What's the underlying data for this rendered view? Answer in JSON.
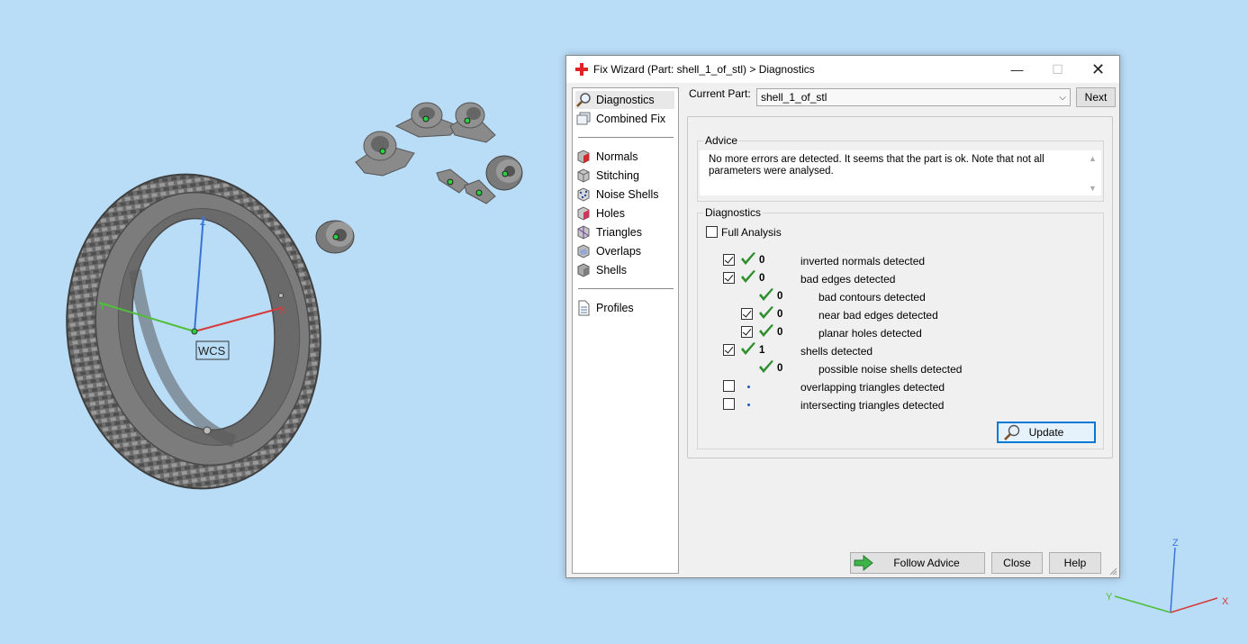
{
  "viewport": {
    "background": "#b9dcf7",
    "wcs_label": "WCS",
    "axes": {
      "x": "X",
      "y": "Y",
      "z": "Z"
    },
    "colors": {
      "x_axis": "#d63a3a",
      "y_axis": "#4fbf3a",
      "z_axis": "#3a73d6",
      "part": "#7a7a7a"
    }
  },
  "dialog": {
    "title": "Fix Wizard (Part: shell_1_of_stl) > Diagnostics",
    "title_icon": "red-cross-icon",
    "window_controls": {
      "minimize": "—",
      "maximize": "☐",
      "close": "✕"
    },
    "nav": {
      "items": [
        {
          "label": "Diagnostics",
          "icon": "magnifier-icon",
          "selected": true
        },
        {
          "label": "Combined Fix",
          "icon": "stack-icon"
        },
        {
          "label": "Normals",
          "icon": "cube-red-face-icon"
        },
        {
          "label": "Stitching",
          "icon": "cube-stitch-icon"
        },
        {
          "label": "Noise Shells",
          "icon": "cube-noise-icon"
        },
        {
          "label": "Holes",
          "icon": "cube-hole-icon"
        },
        {
          "label": "Triangles",
          "icon": "cube-triangle-icon"
        },
        {
          "label": "Overlaps",
          "icon": "cube-overlap-icon"
        },
        {
          "label": "Shells",
          "icon": "cube-shells-icon"
        },
        {
          "label": "Profiles",
          "icon": "document-icon"
        }
      ]
    },
    "current_part": {
      "label": "Current Part:",
      "value": "shell_1_of_stl"
    },
    "next_label": "Next",
    "advice": {
      "title": "Advice",
      "text": "No more errors are detected. It seems that the part is ok. Note that not all parameters were analysed."
    },
    "diagnostics": {
      "title": "Diagnostics",
      "full_analysis": {
        "label": "Full Analysis",
        "checked": false
      },
      "rows": [
        {
          "checkbox": true,
          "checked": true,
          "status": "ok",
          "count": "0",
          "label": "inverted normals detected",
          "indent": 0
        },
        {
          "checkbox": true,
          "checked": true,
          "status": "ok",
          "count": "0",
          "label": "bad edges detected",
          "indent": 0
        },
        {
          "checkbox": false,
          "checked": false,
          "status": "ok",
          "count": "0",
          "label": "bad contours detected",
          "indent": 1
        },
        {
          "checkbox": true,
          "checked": true,
          "status": "ok",
          "count": "0",
          "label": "near bad edges detected",
          "indent": 1
        },
        {
          "checkbox": true,
          "checked": true,
          "status": "ok",
          "count": "0",
          "label": "planar holes detected",
          "indent": 1
        },
        {
          "checkbox": true,
          "checked": true,
          "status": "ok",
          "count": "1",
          "label": "shells detected",
          "indent": 0
        },
        {
          "checkbox": false,
          "checked": false,
          "status": "ok",
          "count": "0",
          "label": "possible noise shells detected",
          "indent": 1
        },
        {
          "checkbox": true,
          "checked": false,
          "status": "pending",
          "count": "",
          "label": "overlapping triangles detected",
          "indent": 0
        },
        {
          "checkbox": true,
          "checked": false,
          "status": "pending",
          "count": "",
          "label": "intersecting triangles detected",
          "indent": 0
        }
      ],
      "update_label": "Update"
    },
    "buttons": {
      "follow_advice": "Follow Advice",
      "close": "Close",
      "help": "Help"
    },
    "colors": {
      "accent": "#0078d7",
      "check_green": "#2f8f2f",
      "pending_dot": "#1f57b8"
    }
  }
}
